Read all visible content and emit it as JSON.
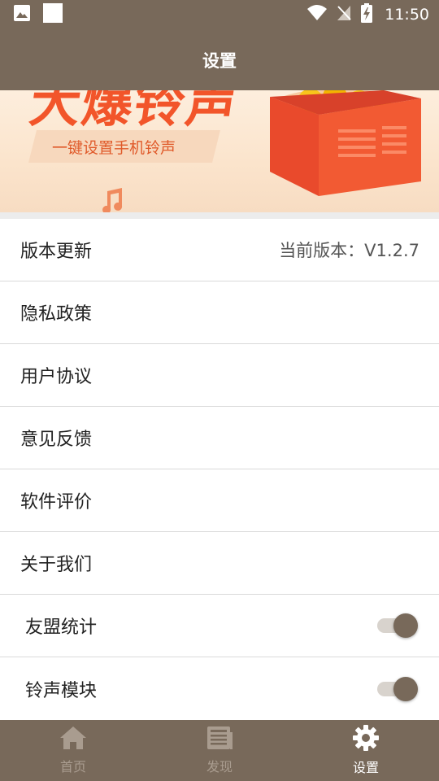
{
  "status_bar": {
    "time": "11:50"
  },
  "app_bar": {
    "title": "设置"
  },
  "banner": {
    "headline": "大爆铃声",
    "slogan": "一键设置手机铃声"
  },
  "settings": {
    "items": [
      {
        "label": "版本更新",
        "value": "当前版本：V1.2.7"
      },
      {
        "label": "隐私政策"
      },
      {
        "label": "用户协议"
      },
      {
        "label": "意见反馈"
      },
      {
        "label": "软件评价"
      },
      {
        "label": "关于我们"
      },
      {
        "label": "友盟统计",
        "toggle_on": true
      },
      {
        "label": "铃声模块",
        "toggle_on": true
      }
    ]
  },
  "bottom_nav": {
    "items": [
      {
        "label": "首页",
        "icon": "home-icon",
        "active": false
      },
      {
        "label": "发现",
        "icon": "news-icon",
        "active": false
      },
      {
        "label": "设置",
        "icon": "gear-icon",
        "active": true
      }
    ]
  },
  "colors": {
    "brand": "#78695a",
    "nav_inactive": "#a99c8f",
    "banner_accent": "#f2552a"
  }
}
